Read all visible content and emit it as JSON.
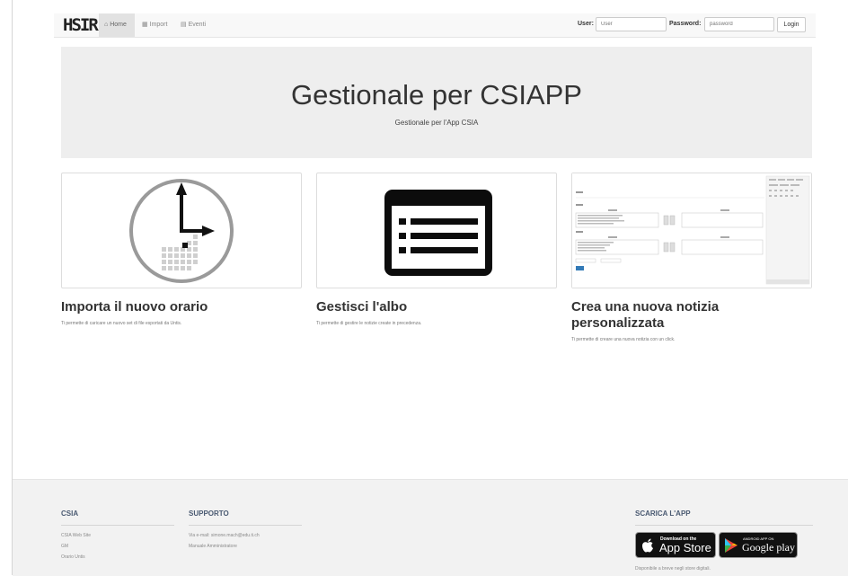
{
  "nav": {
    "brand": "HSIR",
    "items": [
      {
        "icon": "home-icon",
        "glyph": "⌂",
        "label": "Home"
      },
      {
        "icon": "calendar-icon",
        "glyph": "▦",
        "label": "Import"
      },
      {
        "icon": "list-icon",
        "glyph": "▤",
        "label": "Eventi"
      }
    ],
    "user_label": "User:",
    "user_placeholder": "User",
    "password_label": "Password:",
    "password_placeholder": "password",
    "login_label": "Login"
  },
  "hero": {
    "title": "Gestionale per CSIAPP",
    "subtitle": "Gestionale per l'App CSIA"
  },
  "cards": [
    {
      "icon": "clock-icon",
      "title": "Importa il nuovo orario",
      "text": "Ti permette di caricare un nuovo set di file esportati da Untis."
    },
    {
      "icon": "list-board-icon",
      "title": "Gestisci l'albo",
      "text": "Ti permette di gestire le notizie create in precedenza."
    },
    {
      "icon": "editor-screenshot",
      "title": "Crea una nuova notizia personalizzata",
      "text": "Ti permette di creare una nuova notizia con un click."
    }
  ],
  "footer": {
    "csia": {
      "heading": "CSIA",
      "links": [
        "CSIA Web Site",
        "GM",
        "Orario Untis"
      ]
    },
    "supporto": {
      "heading": "SUPPORTO",
      "links": [
        "Via e-mail: simone.mach@edu.ti.ch",
        "Manuale Amministratore"
      ]
    },
    "app": {
      "heading": "SCARICA L'APP",
      "appstore_small": "Download on the",
      "appstore_big": "App Store",
      "gplay_small": "ANDROID APP ON",
      "gplay_big": "Google play",
      "note": "Disponibile a breve negli store digitali."
    }
  },
  "colors": {
    "footer_heading": "#4a5a72",
    "jumbotron_bg": "#eeeeee",
    "primary_button": "#337ab7"
  }
}
